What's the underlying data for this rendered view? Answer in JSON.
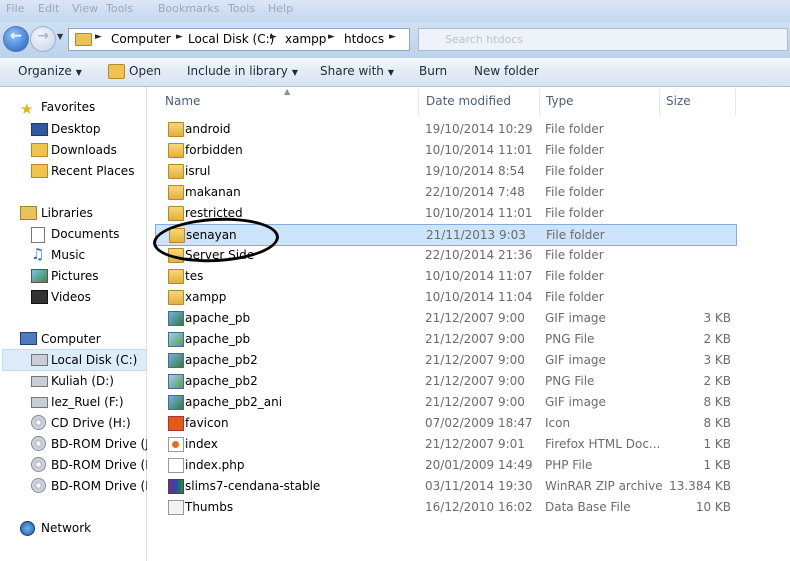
{
  "menubar": {
    "items": [
      "File",
      "Edit",
      "View",
      "Tools",
      "Bookmarks",
      "Tools",
      "Help"
    ]
  },
  "address": {
    "crumbs": [
      "Computer",
      "Local Disk (C:)",
      "xampp",
      "htdocs"
    ],
    "search_placeholder": "Search htdocs"
  },
  "toolbar": {
    "organize": "Organize",
    "open": "Open",
    "include": "Include in library",
    "share": "Share with",
    "burn": "Burn",
    "new_folder": "New folder"
  },
  "nav": {
    "favorites": "Favorites",
    "desktop": "Desktop",
    "downloads": "Downloads",
    "recent": "Recent Places",
    "libraries": "Libraries",
    "documents": "Documents",
    "music": "Music",
    "pictures": "Pictures",
    "videos": "Videos",
    "computer": "Computer",
    "drives": [
      "Local Disk (C:)",
      "Kuliah (D:)",
      "Iez_Ruel (F:)",
      "CD Drive (H:)",
      "BD-ROM Drive (J:)",
      "BD-ROM Drive (K:",
      "BD-ROM Drive (M"
    ],
    "network": "Network"
  },
  "columns": {
    "name": "Name",
    "date": "Date modified",
    "type": "Type",
    "size": "Size"
  },
  "files": [
    {
      "name": "android",
      "date": "19/10/2014 10:29",
      "type": "File folder",
      "size": "",
      "icon": "folder-icon"
    },
    {
      "name": "forbidden",
      "date": "10/10/2014 11:01",
      "type": "File folder",
      "size": "",
      "icon": "folder-icon"
    },
    {
      "name": "isrul",
      "date": "19/10/2014 8:54",
      "type": "File folder",
      "size": "",
      "icon": "folder-icon"
    },
    {
      "name": "makanan",
      "date": "22/10/2014 7:48",
      "type": "File folder",
      "size": "",
      "icon": "folder-icon"
    },
    {
      "name": "restricted",
      "date": "10/10/2014 11:01",
      "type": "File folder",
      "size": "",
      "icon": "folder-icon"
    },
    {
      "name": "senayan",
      "date": "21/11/2013 9:03",
      "type": "File folder",
      "size": "",
      "icon": "folder-icon"
    },
    {
      "name": "Server Side",
      "date": "22/10/2014 21:36",
      "type": "File folder",
      "size": "",
      "icon": "folder-icon"
    },
    {
      "name": "tes",
      "date": "10/10/2014 11:07",
      "type": "File folder",
      "size": "",
      "icon": "folder-icon"
    },
    {
      "name": "xampp",
      "date": "10/10/2014 11:04",
      "type": "File folder",
      "size": "",
      "icon": "folder-icon"
    },
    {
      "name": "apache_pb",
      "date": "21/12/2007 9:00",
      "type": "GIF image",
      "size": "3 KB",
      "icon": "gif-image-icon"
    },
    {
      "name": "apache_pb",
      "date": "21/12/2007 9:00",
      "type": "PNG File",
      "size": "2 KB",
      "icon": "png-image-icon"
    },
    {
      "name": "apache_pb2",
      "date": "21/12/2007 9:00",
      "type": "GIF image",
      "size": "3 KB",
      "icon": "gif-image-icon"
    },
    {
      "name": "apache_pb2",
      "date": "21/12/2007 9:00",
      "type": "PNG File",
      "size": "2 KB",
      "icon": "png-image-icon"
    },
    {
      "name": "apache_pb2_ani",
      "date": "21/12/2007 9:00",
      "type": "GIF image",
      "size": "8 KB",
      "icon": "gif-image-icon"
    },
    {
      "name": "favicon",
      "date": "07/02/2009 18:47",
      "type": "Icon",
      "size": "8 KB",
      "icon": "favicon-icon"
    },
    {
      "name": "index",
      "date": "21/12/2007 9:01",
      "type": "Firefox HTML Doc...",
      "size": "1 KB",
      "icon": "html-file-icon"
    },
    {
      "name": "index.php",
      "date": "20/01/2009 14:49",
      "type": "PHP File",
      "size": "1 KB",
      "icon": "php-file-icon"
    },
    {
      "name": "slims7-cendana-stable",
      "date": "03/11/2014 19:30",
      "type": "WinRAR ZIP archive",
      "size": "13.384 KB",
      "icon": "winrar-archive-icon"
    },
    {
      "name": "Thumbs",
      "date": "16/12/2010 16:02",
      "type": "Data Base File",
      "size": "10 KB",
      "icon": "database-file-icon"
    }
  ],
  "selected_file": "senayan"
}
